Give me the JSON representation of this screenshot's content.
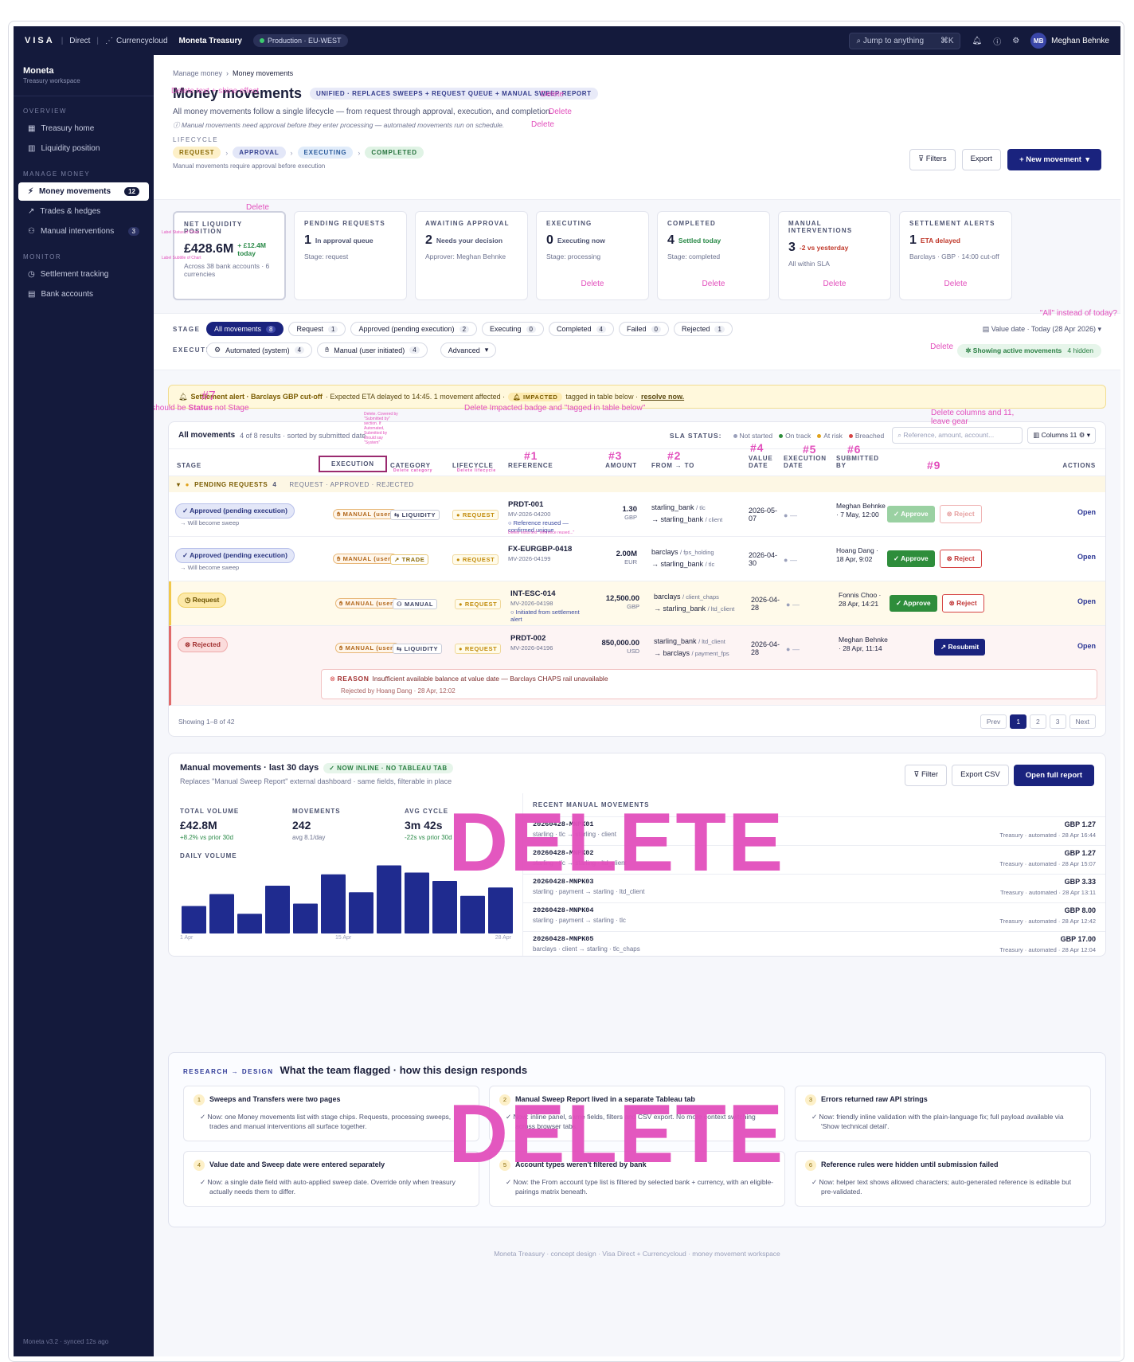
{
  "topbar": {
    "brand": "VISA",
    "direct": "Direct",
    "currencycloud": "Currencycloud",
    "app_name": "Moneta Treasury",
    "env": "Production · EU-WEST",
    "search_placeholder": "Jump to anything",
    "search_shortcut": "⌘K",
    "user_initials": "MB",
    "user_name": "Meghan Behnke"
  },
  "sidebar": {
    "workspace": "Moneta",
    "workspace_sub": "Treasury workspace",
    "sections": [
      {
        "title": "OVERVIEW",
        "items": [
          {
            "label": "Treasury home",
            "icon": "grid-icon"
          },
          {
            "label": "Liquidity position",
            "icon": "chart-icon"
          }
        ]
      },
      {
        "title": "MANAGE MONEY",
        "items": [
          {
            "label": "Money movements",
            "icon": "bolt-icon",
            "badge": "12",
            "active": true
          },
          {
            "label": "Trades & hedges",
            "icon": "trend-icon"
          },
          {
            "label": "Manual interventions",
            "icon": "users-icon",
            "badge": "3"
          }
        ]
      },
      {
        "title": "MONITOR",
        "items": [
          {
            "label": "Settlement tracking",
            "icon": "clock-icon"
          },
          {
            "label": "Bank accounts",
            "icon": "bank-icon"
          }
        ]
      }
    ],
    "footer": "Moneta v3.2 · synced 12s ago"
  },
  "header": {
    "breadcrumb_parent": "Manage money",
    "breadcrumb_current": "Money movements",
    "title": "Money movements",
    "tag": "UNIFIED · REPLACES SWEEPS + REQUEST QUEUE + MANUAL SWEEP REPORT",
    "subtitle": "All money movements follow a single lifecycle — from request through approval, execution, and completion.",
    "note": "Manual movements need approval before they enter processing — automated movements run on schedule.",
    "lifecycle_label": "LIFECYCLE",
    "lifecycle": [
      "REQUEST",
      "APPROVAL",
      "EXECUTING",
      "COMPLETED"
    ],
    "lifecycle_note": "Manual movements require approval before execution",
    "filters_btn": "Filters",
    "export_btn": "Export",
    "new_btn": "New movement"
  },
  "annotations": {
    "title_overlay": "Delete text + shine effect",
    "delete": "Delete",
    "label_status_1": "Label Status of Chart",
    "label_status_2": "Label Subtitle of Chart",
    "all_instead": "\"All\" instead of today?",
    "marker_7": "#7",
    "status_not_stage_pre": "Label should be ",
    "status_not_stage_bold": "Status",
    "status_not_stage_post": " not Stage",
    "delete_impacted": "Delete Impacted badge and \"tagged in table below\"",
    "delete_columns": "Delete columns and 11, leave gear",
    "execution_note": "Delete. Covered by \"Submitted by\" section. If Automated, Submitted by should say \"System\"",
    "delete_category": "Delete category",
    "delete_lifecycle": "Delete lifecycle",
    "delete_extra_text": "Delete extra text \"reference reused...\"",
    "m1": "#1",
    "m2": "#2",
    "m3": "#3",
    "m4": "#4",
    "m5": "#5",
    "m6": "#6",
    "m9": "#9",
    "big_delete": "DELETE"
  },
  "cards": [
    {
      "label": "NET LIQUIDITY POSITION",
      "value": "£428.6M",
      "delta": "+ £12.4M today",
      "delta_class": "gr",
      "sub": "Across 38 bank accounts · 6 currencies"
    },
    {
      "label": "PENDING REQUESTS",
      "value": "1",
      "delta": "In approval queue",
      "delta_class": "",
      "sub": "Stage: request"
    },
    {
      "label": "AWAITING APPROVAL",
      "value": "2",
      "delta": "Needs your decision",
      "delta_class": "",
      "sub": "Approver: Meghan Behnke"
    },
    {
      "label": "EXECUTING",
      "value": "0",
      "delta": "Executing now",
      "delta_class": "",
      "sub": "Stage: processing",
      "del": true
    },
    {
      "label": "COMPLETED",
      "value": "4",
      "delta": "Settled today",
      "delta_class": "gr",
      "sub": "Stage: completed",
      "del": true
    },
    {
      "label": "MANUAL INTERVENTIONS",
      "value": "3",
      "delta": "-2 vs yesterday",
      "delta_class": "rd",
      "sub": "All within SLA",
      "del": true
    },
    {
      "label": "SETTLEMENT ALERTS",
      "value": "1",
      "delta": "ETA delayed",
      "delta_class": "rd",
      "sub": "Barclays · GBP · 14:00 cut-off",
      "del": true
    }
  ],
  "filters": {
    "stage_label": "STAGE",
    "stage_chips": [
      {
        "label": "All movements",
        "n": "8",
        "on": true
      },
      {
        "label": "Request",
        "n": "1"
      },
      {
        "label": "Approved (pending execution)",
        "n": "2"
      },
      {
        "label": "Executing",
        "n": "0"
      },
      {
        "label": "Completed",
        "n": "4"
      },
      {
        "label": "Failed",
        "n": "0"
      },
      {
        "label": "Rejected",
        "n": "1"
      }
    ],
    "exec_label": "EXECUTION",
    "exec_chips": [
      {
        "label": "Automated (system)",
        "n": "4"
      },
      {
        "label": "Manual (user initiated)",
        "n": "4"
      }
    ],
    "advanced": "Advanced",
    "value_date": "Value date · Today (28 Apr 2026)",
    "showing": "Showing active movements",
    "hidden": "4 hidden"
  },
  "alert": {
    "title": "Settlement alert · Barclays GBP cut-off",
    "text": " · Expected ETA delayed to 14:45. 1 movement affected · ",
    "badge": "IMPACTED",
    "tagged": " tagged in table below · ",
    "link": "resolve now."
  },
  "table": {
    "title": "All movements",
    "meta": "4 of 8 results · sorted by submitted date",
    "sla_label": "SLA STATUS:",
    "sla": [
      {
        "label": "Not started",
        "color": "#9aa0bb"
      },
      {
        "label": "On track",
        "color": "#2e8d3b"
      },
      {
        "label": "At risk",
        "color": "#e0a21a"
      },
      {
        "label": "Breached",
        "color": "#d64545"
      }
    ],
    "search_placeholder": "Reference, amount, account...",
    "columns_btn": "Columns",
    "columns_n": "11",
    "headers": [
      "STAGE",
      "EXECUTION",
      "CATEGORY",
      "LIFECYCLE",
      "REFERENCE",
      "AMOUNT",
      "FROM → TO",
      "VALUE DATE",
      "EXECUTION DATE",
      "SUBMITTED BY",
      "ACTIONS"
    ],
    "group": "PENDING REQUESTS",
    "group_n": "4",
    "group_sub": "REQUEST · APPROVED · REJECTED",
    "rows": [
      {
        "stage": "Approved (pending execution)",
        "stage_kind": "ap",
        "will": "Will become sweep",
        "exec": "MANUAL (user)",
        "cat": "LIQUIDITY",
        "lc": "REQUEST",
        "ref": "PRDT-001",
        "id": "MV-2026-04200",
        "extra": "Reference reused — confirmed unique",
        "amt": "1.30",
        "ccy": "GBP",
        "from": "starling_bank",
        "from_s": "/ tlc",
        "to": "starling_bank",
        "to_s": "/ client",
        "vd": "2026-05-07",
        "ed": "—",
        "by": "Meghan Behnke · 7 May, 12:00",
        "dim": true
      },
      {
        "stage": "Approved (pending execution)",
        "stage_kind": "ap",
        "will": "Will become sweep",
        "exec": "MANUAL (user)",
        "cat": "TRADE",
        "lc": "REQUEST",
        "ref": "FX-EURGBP-0418",
        "id": "MV-2026-04199",
        "extra": "",
        "amt": "2.00M",
        "ccy": "EUR",
        "from": "barclays",
        "from_s": "/ fps_holding",
        "to": "starling_bank",
        "to_s": "/ tlc",
        "vd": "2026-04-30",
        "ed": "—",
        "by": "Hoang Dang · 18 Apr, 9:02"
      },
      {
        "stage": "Request",
        "stage_kind": "rq",
        "will": "",
        "exec": "MANUAL (user)",
        "cat": "MANUAL",
        "lc": "REQUEST",
        "ref": "INT-ESC-014",
        "id": "MV-2026-04198",
        "extra": "Initiated from settlement alert",
        "amt": "12,500.00",
        "ccy": "GBP",
        "from": "barclays",
        "from_s": "/ client_chaps",
        "to": "starling_bank",
        "to_s": "/ ltd_client",
        "vd": "2026-04-28",
        "ed": "—",
        "by": "Fonnis Choo · 28 Apr, 14:21"
      },
      {
        "stage": "Rejected",
        "stage_kind": "rj",
        "will": "",
        "exec": "MANUAL (user)",
        "cat": "LIQUIDITY",
        "lc": "REQUEST",
        "ref": "PRDT-002",
        "id": "MV-2026-04196",
        "extra": "",
        "amt": "850,000.00",
        "ccy": "USD",
        "from": "starling_bank",
        "from_s": "/ ltd_client",
        "to": "barclays",
        "to_s": "/ payment_fps",
        "vd": "2026-04-28",
        "ed": "—",
        "by": "Meghan Behnke · 28 Apr, 11:14"
      }
    ],
    "approve": "Approve",
    "reject": "Reject",
    "resubmit": "Resubmit",
    "open": "Open",
    "reason_label": "REASON",
    "reason": "Insufficient available balance at value date — Barclays CHAPS rail unavailable",
    "reason_by": "Rejected by Hoang Dang · 28 Apr, 12:02",
    "showing": "Showing 1–8 of 42",
    "prev": "Prev",
    "next": "Next",
    "pages": [
      "1",
      "2",
      "3"
    ]
  },
  "manual": {
    "title": "Manual movements · last 30 days",
    "tag": "NOW INLINE · NO TABLEAU TAB",
    "sub": "Replaces \"Manual Sweep Report\" external dashboard · same fields, filterable in place",
    "filter": "Filter",
    "export": "Export CSV",
    "open": "Open full report",
    "stats": [
      {
        "label": "TOTAL VOLUME",
        "value": "£42.8M",
        "sub": "+8.2% vs prior 30d",
        "gr": true
      },
      {
        "label": "MOVEMENTS",
        "value": "242",
        "sub": "avg 8.1/day"
      },
      {
        "label": "AVG CYCLE",
        "value": "3m 42s",
        "sub": "-22s vs prior 30d",
        "gr": true
      }
    ],
    "daily_label": "DAILY VOLUME",
    "axis": [
      "1 Apr",
      "15 Apr",
      "28 Apr"
    ],
    "recent_label": "RECENT MANUAL MOVEMENTS",
    "recent": [
      {
        "id": "20260428-MNPK01",
        "flow": "starling · tlc → starling · client",
        "amt": "GBP 1.27",
        "meta": "Treasury · automated · 28 Apr 16:44"
      },
      {
        "id": "20260428-MNPK02",
        "flow": "starling · tlc → starling · ltd_client",
        "amt": "GBP 1.27",
        "meta": "Treasury · automated · 28 Apr 15:07"
      },
      {
        "id": "20260428-MNPK03",
        "flow": "starling · payment → starling · ltd_client",
        "amt": "GBP 3.33",
        "meta": "Treasury · automated · 28 Apr 13:11"
      },
      {
        "id": "20260428-MNPK04",
        "flow": "starling · payment → starling · tlc",
        "amt": "GBP 8.00",
        "meta": "Treasury · automated · 28 Apr 12:42"
      },
      {
        "id": "20260428-MNPK05",
        "flow": "barclays · client → starling · tlc_chaps",
        "amt": "GBP 17.00",
        "meta": "Treasury · automated · 28 Apr 12:04"
      }
    ]
  },
  "chart_data": {
    "type": "bar",
    "categories": [
      "1",
      "2",
      "3",
      "4",
      "5",
      "6",
      "7",
      "8",
      "9",
      "10",
      "11",
      "12"
    ],
    "values": [
      4.6,
      6.6,
      3.3,
      8.0,
      5.0,
      9.9,
      6.9,
      11.4,
      10.2,
      8.8,
      6.3,
      7.7
    ],
    "ylim": [
      0,
      12
    ],
    "xlabel": "",
    "ylabel": "",
    "color": "#1f2b8f",
    "grid": false
  },
  "research": {
    "label": "RESEARCH → DESIGN",
    "title": "What the team flagged · how this design responds",
    "items": [
      {
        "n": "1",
        "t": "Sweeps and Transfers were two pages",
        "d": "Now: one Money movements list with stage chips. Requests, processing sweeps, trades and manual interventions all surface together."
      },
      {
        "n": "2",
        "t": "Manual Sweep Report lived in a separate Tableau tab",
        "d": "Now: inline panel, same fields, filters and CSV export. No more context switching across browser tabs."
      },
      {
        "n": "3",
        "t": "Errors returned raw API strings",
        "d": "Now: friendly inline validation with the plain-language fix; full payload available via 'Show technical detail'."
      },
      {
        "n": "4",
        "t": "Value date and Sweep date were entered separately",
        "d": "Now: a single date field with auto-applied sweep date. Override only when treasury actually needs them to differ."
      },
      {
        "n": "5",
        "t": "Account types weren't filtered by bank",
        "d": "Now: the From account type list is filtered by selected bank + currency, with an eligible-pairings matrix beneath."
      },
      {
        "n": "6",
        "t": "Reference rules were hidden until submission failed",
        "d": "Now: helper text shows allowed characters; auto-generated reference is editable but pre-validated."
      }
    ]
  },
  "footer": "Moneta Treasury · concept design · Visa Direct + Currencycloud · money movement workspace"
}
